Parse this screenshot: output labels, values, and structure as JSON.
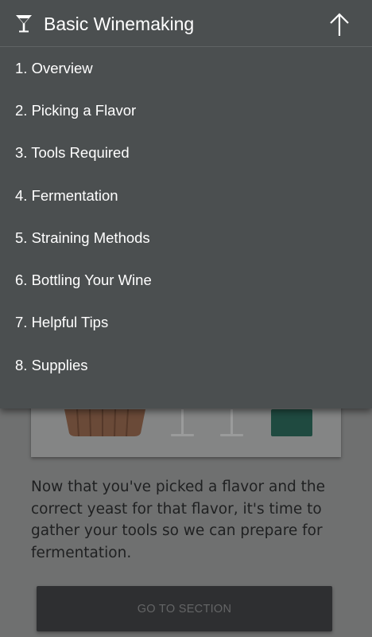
{
  "app": {
    "title": "Basic Winemaking",
    "icons": {
      "logo": "wine-glass-icon",
      "up": "arrow-up-icon"
    }
  },
  "menu": {
    "items": [
      {
        "label": "1. Overview"
      },
      {
        "label": "2. Picking a Flavor"
      },
      {
        "label": "3. Tools Required"
      },
      {
        "label": "4. Fermentation"
      },
      {
        "label": "5. Straining Methods"
      },
      {
        "label": "6. Bottling Your Wine"
      },
      {
        "label": "7. Helpful Tips"
      },
      {
        "label": "8. Supplies"
      }
    ]
  },
  "content": {
    "paragraph": "Now that you've picked a flavor and the correct yeast for that flavor, it's time to gather your tools so we can prepare for fermentation.",
    "button_label": "GO TO SECTION"
  },
  "colors": {
    "panel_bg": "#4b4f50",
    "page_bg_dimmed": "#6f7070",
    "text_light": "#ffffff",
    "button_bg": "#2e2f31"
  }
}
